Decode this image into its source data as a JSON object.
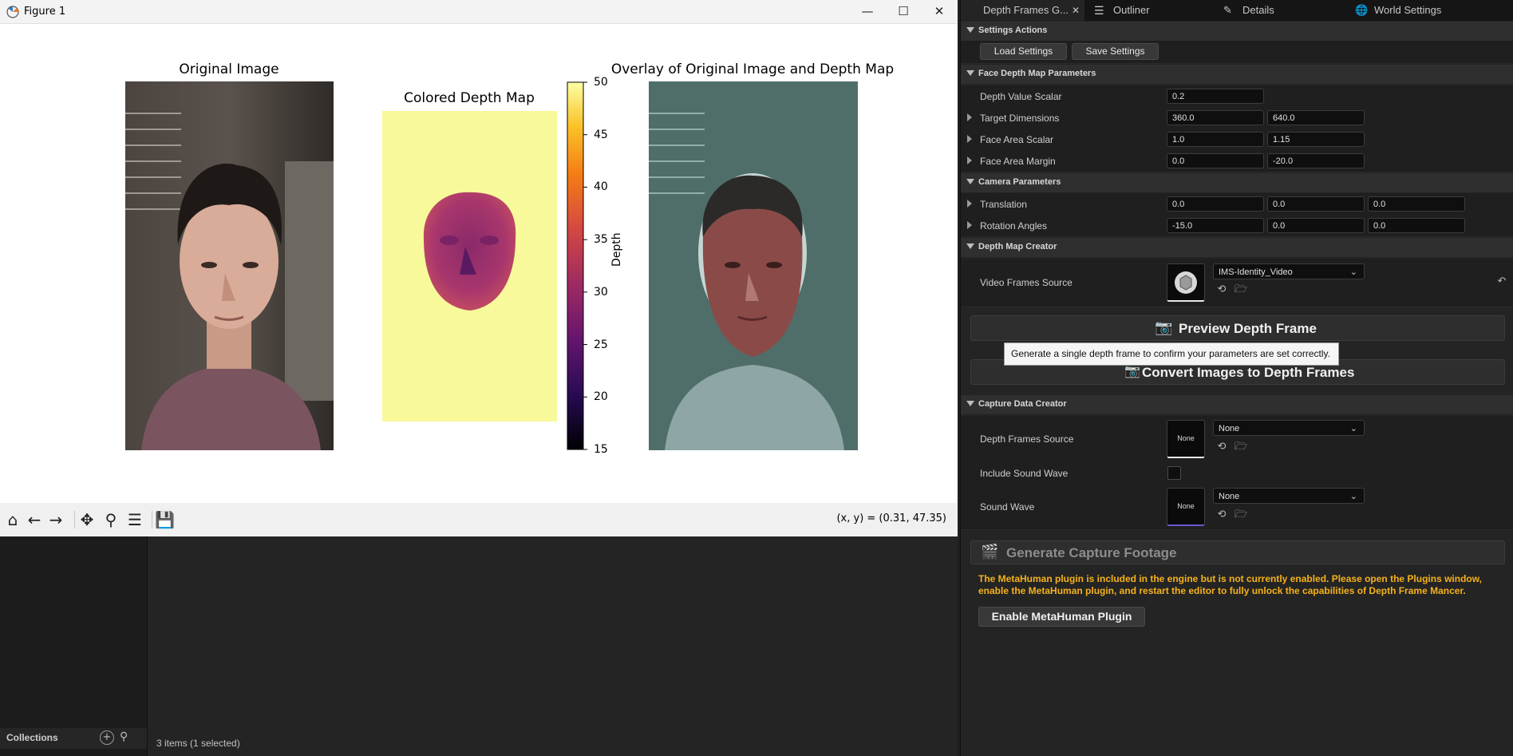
{
  "figure": {
    "window_title": "Figure 1",
    "panel_titles": [
      "Original Image",
      "Colored Depth Map",
      "Overlay of Original Image and Depth Map"
    ],
    "colorbar": {
      "label": "Depth",
      "ticks": [
        "50",
        "45",
        "40",
        "35",
        "30",
        "25",
        "20",
        "15"
      ],
      "colormap": "inferno-like"
    },
    "coords_readout": "(x, y) = (0.31, 47.35)",
    "toolbar_icons": [
      "home-icon",
      "back-arrow-icon",
      "forward-arrow-icon",
      "pan-icon",
      "zoom-icon",
      "configure-icon",
      "save-icon"
    ]
  },
  "content_browser": {
    "collections_label": "Collections",
    "status": "3 items (1 selected)"
  },
  "tabs": [
    {
      "label": "Depth Frames G...",
      "icon": "close-icon"
    },
    {
      "label": "Outliner",
      "icon": "outliner-icon"
    },
    {
      "label": "Details",
      "icon": "pencil-icon"
    },
    {
      "label": "World Settings",
      "icon": "globe-icon"
    }
  ],
  "sections": {
    "settings_actions": "Settings Actions",
    "face_depth": "Face Depth Map Parameters",
    "camera": "Camera Parameters",
    "depth_map_creator": "Depth Map Creator",
    "capture_data_creator": "Capture Data Creator"
  },
  "settings_actions": {
    "load": "Load Settings",
    "save": "Save Settings"
  },
  "face_depth": {
    "depth_value_scalar": {
      "label": "Depth Value Scalar",
      "value": "0.2"
    },
    "target_dimensions": {
      "label": "Target Dimensions",
      "v1": "360.0",
      "v2": "640.0"
    },
    "face_area_scalar": {
      "label": "Face Area Scalar",
      "v1": "1.0",
      "v2": "1.15"
    },
    "face_area_margin": {
      "label": "Face Area Margin",
      "v1": "0.0",
      "v2": "-20.0"
    }
  },
  "camera": {
    "translation": {
      "label": "Translation",
      "v1": "0.0",
      "v2": "0.0",
      "v3": "0.0"
    },
    "rotation": {
      "label": "Rotation Angles",
      "v1": "-15.0",
      "v2": "0.0",
      "v3": "0.0"
    }
  },
  "depth_map_creator": {
    "video_frames_source": {
      "label": "Video Frames Source",
      "value": "IMS-Identity_Video"
    },
    "preview_button": "Preview Depth Frame",
    "tooltip": "Generate a single depth frame to confirm your parameters are set correctly.",
    "convert_button": "Convert Images to Depth Frames"
  },
  "capture_data_creator": {
    "depth_frames_source": {
      "label": "Depth Frames Source",
      "value": "None",
      "thumb": "None"
    },
    "include_sound_wave": {
      "label": "Include Sound Wave",
      "checked": false
    },
    "sound_wave": {
      "label": "Sound Wave",
      "value": "None",
      "thumb": "None"
    },
    "generate_button": "Generate Capture Footage",
    "warning": "The MetaHuman plugin is included in the engine but is not currently enabled. Please open the Plugins window, enable the MetaHuman plugin, and restart the editor to fully unlock the capabilities of Depth Frame Mancer.",
    "enable_button": "Enable MetaHuman Plugin"
  },
  "colors": {
    "warning": "#f5b21b",
    "accent_underline": "#6a5ad0"
  }
}
